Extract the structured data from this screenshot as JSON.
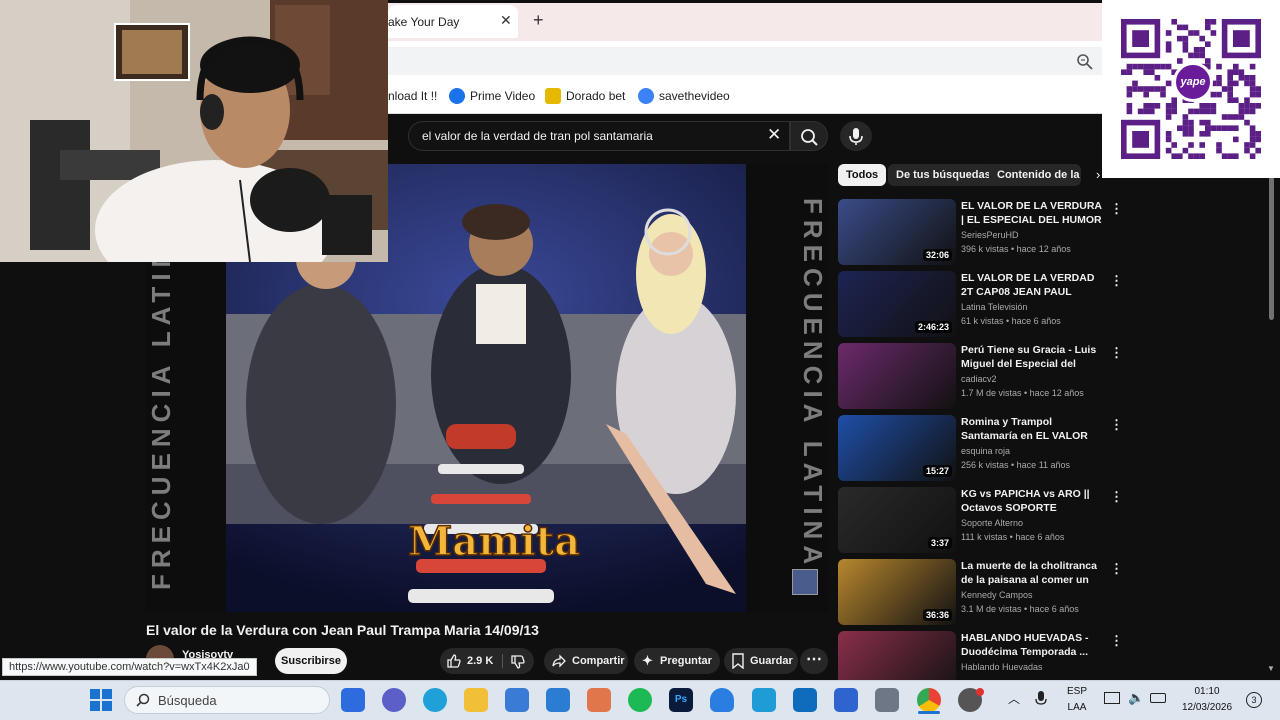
{
  "browser": {
    "tab_title": "ake Your Day",
    "tab_close": "✕",
    "new_tab": "+",
    "bookmarks": [
      "nload It !!",
      "Prime Video",
      "Dorado bet",
      "savethevideo"
    ]
  },
  "youtube": {
    "search_query": "el valor de la verdad de tran pol santamaria",
    "video": {
      "title": "El valor de la Verdura con Jean Paul Trampa Maria 14/09/13",
      "channel": "Yosisoytv",
      "subscribe": "Suscribirse",
      "likes": "2.9 K",
      "share": "Compartir",
      "ask": "Preguntar",
      "save": "Guardar",
      "overlay_text": "Mamita",
      "watermark": "FRECUENCIA LATINA"
    },
    "status_url": "https://www.youtube.com/watch?v=wxTx4K2xJa0",
    "chips": [
      "Todos",
      "De tus búsquedas",
      "Contenido de la se"
    ],
    "recommendations": [
      {
        "title": "EL VALOR DE LA VERDURA | EL ESPECIAL DEL HUMOR ...",
        "channel": "SeriesPeruHD",
        "meta": "396 k vistas • hace 12 años",
        "duration": "32:06",
        "color": "#3a4c8a"
      },
      {
        "title": "EL VALOR DE LA VERDAD 2T CAP08 JEAN PAUL SANTA ...",
        "channel": "Latina Televisión",
        "meta": "61 k vistas • hace 6 años",
        "duration": "2:46:23",
        "color": "#1d2454"
      },
      {
        "title": "Perú Tiene su Gracia - Luis Miguel del Especial del Humor...",
        "channel": "cadiacv2",
        "meta": "1.7 M de vistas • hace 12 años",
        "duration": "",
        "color": "#6b2a6b"
      },
      {
        "title": "Romina y Trampol Santamaría en EL VALOR DE LA VERDURA...",
        "channel": "esquina roja",
        "meta": "256 k vistas • hace 11 años",
        "duration": "15:27",
        "color": "#1e4fa8"
      },
      {
        "title": "KG vs PAPICHA vs ARO || Octavos SOPORTE ALTERNO",
        "channel": "Soporte Alterno",
        "meta": "111 k vistas • hace 6 años",
        "duration": "3:37",
        "color": "#2a2a2a"
      },
      {
        "title": "La muerte de la cholitranca de la paisana al comer un tamal",
        "channel": "Kennedy Campos",
        "meta": "3.1 M de vistas • hace 6 años",
        "duration": "36:36",
        "color": "#b8872f"
      },
      {
        "title": "HABLANDO HUEVADAS - Duodécima Temporada ...",
        "channel": "Hablando Huevadas",
        "meta": "",
        "duration": "",
        "color": "#8a2f4a"
      }
    ]
  },
  "taskbar": {
    "search": "Búsqueda",
    "lang_top": "ESP",
    "lang_bottom": "LAA",
    "time": "01:10",
    "date": "12/03/2026",
    "notif_count": "3"
  },
  "qr": {
    "brand": "yape"
  }
}
